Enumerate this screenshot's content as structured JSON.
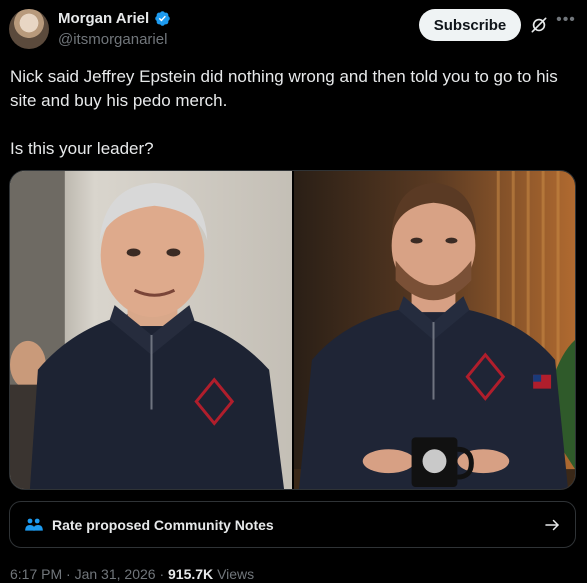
{
  "author": {
    "name": "Morgan Ariel",
    "handle": "@itsmorganariel",
    "verified": true
  },
  "header": {
    "subscribe_label": "Subscribe",
    "grok_icon": "grok-icon",
    "more_icon": "more-icon"
  },
  "tweet": {
    "line1": "Nick said Jeffrey Epstein did nothing wrong and then told you to go to his site and buy his pedo merch.",
    "line2": "Is this your leader?"
  },
  "media": {
    "count": 2
  },
  "community_notes": {
    "label": "Rate proposed Community Notes",
    "icon": "people-icon",
    "arrow_icon": "arrow-right-icon"
  },
  "meta": {
    "time": "6:17 PM",
    "separator": " · ",
    "date": "Jan 31, 2026",
    "views_count": "915.7K",
    "views_label": "Views"
  },
  "colors": {
    "background": "#000000",
    "text_primary": "#e7e9ea",
    "text_secondary": "#71767b",
    "verified_blue": "#1d9bf0",
    "border": "#2f3336",
    "subscribe_bg": "#eff3f4"
  }
}
